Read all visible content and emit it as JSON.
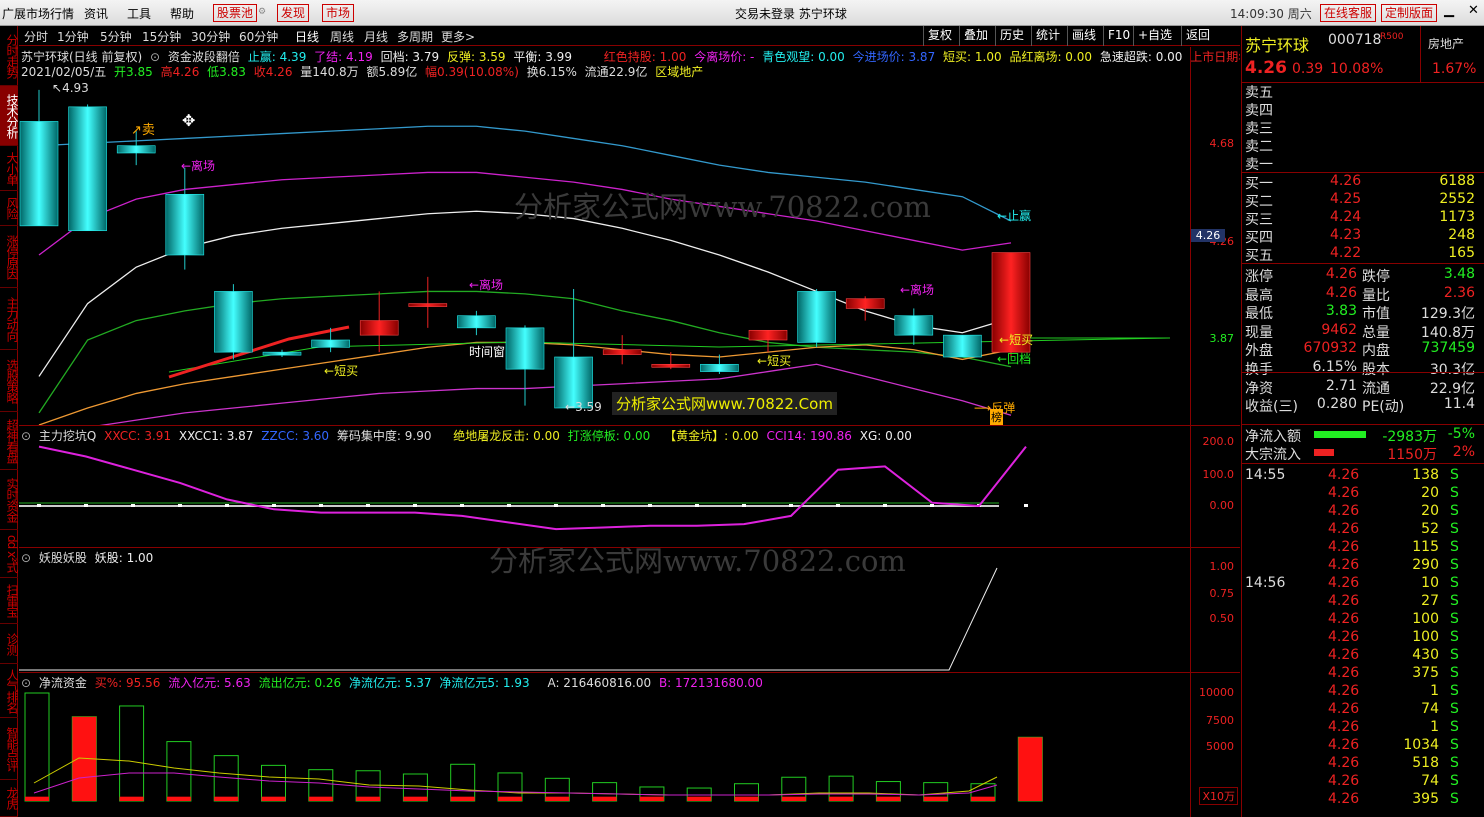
{
  "menubar": {
    "items": [
      "广展市场行情",
      "资讯",
      "工具",
      "帮助"
    ],
    "boxed": [
      "股票池",
      "发现",
      "市场"
    ],
    "center_title": "交易未登录  苏宁环球",
    "time": "14:09:30 周六",
    "btn_online": "在线客服",
    "btn_custom": "定制版面"
  },
  "left_tabs": [
    "分时走势",
    "技术分析",
    "大小单",
    "风险",
    "涨停原因",
    "主力动向",
    "选股策略",
    "超神看盘",
    "实时资金",
    "dd x²式",
    "扫雷宝",
    "诊测",
    "人气排名",
    "智能点评",
    "龙虎"
  ],
  "periods": [
    "分时",
    "1分钟",
    "5分钟",
    "15分钟",
    "30分钟",
    "60分钟",
    "日线",
    "周线",
    "月线",
    "多周期",
    "更多>"
  ],
  "tools": [
    "复权",
    "叠加",
    "历史",
    "统计",
    "画线",
    "F10",
    "+自选",
    "返回"
  ],
  "main": {
    "h1": {
      "name": "苏宁环球(日线 前复权)",
      "ind": "资金波段翻倍",
      "zy": "止赢: 4.39",
      "lj": "了结: 4.19",
      "hd": "回档: 3.79",
      "ft": "反弹: 3.59",
      "ph": "平衡: 3.99",
      "hschg": "红色持股: 1.00",
      "jlcj": "今离场价: -",
      "qsgw": "青色观望: 0.00",
      "jjcj": "今进场价: 3.87",
      "dm": "短买: 1.00",
      "pllc": "品红离场: 0.00",
      "jcsd": "急速超跌: 0.00",
      "ssrq": "上市日期年◇"
    },
    "h2": {
      "date": "2021/02/05/五",
      "open": "开3.85",
      "high": "高4.26",
      "low": "低3.83",
      "close": "收4.26",
      "vol": "量140.8万",
      "amt": "额5.89亿",
      "amp": "幅0.39(10.08%)",
      "turn": "换6.15%",
      "float": "流通22.9亿",
      "sector": "区域地产"
    },
    "price_ticks": [
      "4.68",
      "4.26",
      "3.87"
    ],
    "cur_price_tag": "4.26",
    "marks": {
      "high": "4.93",
      "low": "3.59",
      "sell": "卖",
      "exit": "←离场",
      "shortbuy": "短买",
      "time_window": "时间窗",
      "stop": "止赢",
      "pullback": "回档",
      "bounce": "反弹",
      "rank": "榜"
    },
    "watermark": "分析家公式网www.70822.com",
    "banner": "分析家公式网www.70822.Com"
  },
  "chart_data": {
    "type": "candlestick",
    "ohlc": [
      [
        4.8,
        4.93,
        4.4,
        4.37
      ],
      [
        4.86,
        4.87,
        4.35,
        4.35
      ],
      [
        4.7,
        4.76,
        4.62,
        4.67
      ],
      [
        4.5,
        4.61,
        4.19,
        4.25
      ],
      [
        4.1,
        4.13,
        3.82,
        3.85
      ],
      [
        3.85,
        3.86,
        3.83,
        3.84
      ],
      [
        3.9,
        3.95,
        3.85,
        3.87
      ],
      [
        3.92,
        4.1,
        3.85,
        3.98
      ],
      [
        4.05,
        4.16,
        3.95,
        4.05
      ],
      [
        4.0,
        4.02,
        3.92,
        3.95
      ],
      [
        3.95,
        3.96,
        3.63,
        3.78
      ],
      [
        3.83,
        4.11,
        3.62,
        3.62
      ],
      [
        3.84,
        3.92,
        3.8,
        3.86
      ],
      [
        3.8,
        3.85,
        3.78,
        3.8
      ],
      [
        3.8,
        3.84,
        3.76,
        3.77
      ],
      [
        3.9,
        3.93,
        3.85,
        3.94
      ],
      [
        4.1,
        4.11,
        3.87,
        3.89
      ],
      [
        4.03,
        4.08,
        3.98,
        4.07
      ],
      [
        4.0,
        4.03,
        3.88,
        3.92
      ],
      [
        3.92,
        3.92,
        3.83,
        3.83
      ],
      [
        3.85,
        4.26,
        3.83,
        4.26
      ]
    ],
    "ylim": [
      3.55,
      4.95
    ],
    "bands": {
      "upper": [
        4.7,
        4.71,
        4.72,
        4.73,
        4.74,
        4.75,
        4.76,
        4.77,
        4.78,
        4.78,
        4.76,
        4.73,
        4.7,
        4.66,
        4.62,
        4.59,
        4.57,
        4.55,
        4.52,
        4.49,
        4.39
      ],
      "mid_hi": [
        4.25,
        4.4,
        4.48,
        4.52,
        4.54,
        4.56,
        4.57,
        4.58,
        4.59,
        4.59,
        4.57,
        4.55,
        4.52,
        4.48,
        4.45,
        4.42,
        4.39,
        4.35,
        4.31,
        4.27,
        4.3
      ],
      "mid": [
        3.75,
        4.05,
        4.2,
        4.28,
        4.33,
        4.36,
        4.38,
        4.4,
        4.42,
        4.43,
        4.42,
        4.4,
        4.36,
        4.31,
        4.25,
        4.18,
        4.1,
        4.02,
        3.96,
        3.93,
        3.99
      ],
      "mid_lo": [
        3.6,
        3.9,
        3.98,
        4.02,
        4.05,
        4.07,
        4.08,
        4.09,
        4.1,
        4.1,
        4.09,
        4.07,
        4.02,
        3.98,
        3.93,
        3.89,
        3.87,
        3.86,
        3.85,
        3.83,
        3.79
      ],
      "lower": [
        3.55,
        3.62,
        3.68,
        3.72,
        3.75,
        3.78,
        3.81,
        3.84,
        3.87,
        3.89,
        3.89,
        3.88,
        3.86,
        3.84,
        3.83,
        3.85,
        3.87,
        3.88,
        3.86,
        3.82,
        3.86
      ],
      "bottom": [
        3.5,
        3.54,
        3.57,
        3.6,
        3.62,
        3.64,
        3.66,
        3.68,
        3.69,
        3.7,
        3.7,
        3.71,
        3.72,
        3.73,
        3.74,
        3.77,
        3.8,
        3.75,
        3.7,
        3.65,
        3.59
      ]
    }
  },
  "ind2": {
    "hdr": {
      "name": "主力挖坑Q",
      "xxcc": "XXCC: 3.91",
      "xxcc1": "XXCC1: 3.87",
      "zzcc": "ZZCC: 3.60",
      "chip": "筹码集中度: 9.90",
      "jd": "绝地屠龙反击: 0.00",
      "dz": "打涨停板: 0.00",
      "hj": "【黄金坑】: 0.00",
      "cci": "CCI14: 190.86",
      "xg": "XG: 0.00"
    },
    "ticks": [
      "200.0",
      "100.0",
      "0.00"
    ],
    "cci": [
      180,
      150,
      110,
      70,
      20,
      -10,
      -20,
      -20,
      -20,
      -30,
      -50,
      -70,
      -65,
      -60,
      -60,
      -55,
      -30,
      110,
      120,
      10,
      0,
      180
    ]
  },
  "ind3": {
    "hdr": {
      "name": "妖股妖股",
      "val": "妖股: 1.00"
    },
    "ticks": [
      "1.00",
      "0.75",
      "0.50"
    ]
  },
  "ind4": {
    "hdr": {
      "name": "净流资金",
      "buy": "买%: 95.56",
      "in": "流入亿元: 5.63",
      "out": "流出亿元: 0.26",
      "net": "净流亿元: 5.37",
      "net5": "净流亿元5: 1.93",
      "a": "A: 216460816.00",
      "b": "B: 172131680.00"
    },
    "ticks": [
      "10000",
      "7500",
      "5000"
    ],
    "unit": "X10万",
    "vol": [
      10000,
      7800,
      8800,
      5500,
      4200,
      3300,
      2900,
      2800,
      2500,
      3400,
      2600,
      2100,
      1700,
      1300,
      1200,
      1600,
      2200,
      2300,
      1800,
      1700,
      1600,
      5900
    ],
    "red": [
      400,
      7800,
      400,
      400,
      400,
      400,
      400,
      400,
      400,
      400,
      400,
      400,
      400,
      400,
      400,
      400,
      400,
      400,
      400,
      400,
      400,
      5900
    ]
  },
  "quote": {
    "name": "苏宁环球",
    "code": "000718",
    "tag": "R500",
    "sector": "房地产",
    "price": "4.26",
    "chg": "0.39",
    "pct": "10.08%",
    "rate": "1.67%",
    "asks": [
      "卖五",
      "卖四",
      "卖三",
      "卖二",
      "卖一"
    ],
    "bids": [
      [
        "买一",
        "4.26",
        "6188"
      ],
      [
        "买二",
        "4.25",
        "2552"
      ],
      [
        "买三",
        "4.24",
        "1173"
      ],
      [
        "买四",
        "4.23",
        "248"
      ],
      [
        "买五",
        "4.22",
        "165"
      ]
    ],
    "stats": [
      [
        "涨停",
        "4.26",
        "跌停",
        "3.48"
      ],
      [
        "最高",
        "4.26",
        "量比",
        "2.36"
      ],
      [
        "最低",
        "3.83",
        "市值",
        "129.3亿"
      ],
      [
        "现量",
        "9462",
        "总量",
        "140.8万"
      ],
      [
        "外盘",
        "670932",
        "内盘",
        "737459"
      ],
      [
        "换手",
        "6.15%",
        "股本",
        "30.3亿"
      ],
      [
        "净资",
        "2.71",
        "流通",
        "22.9亿"
      ],
      [
        "收益(三)",
        "0.280",
        "PE(动)",
        "11.4"
      ]
    ],
    "flow": [
      [
        "净流入额",
        "-2983万",
        "-5%"
      ],
      [
        "大宗流入",
        "1150万",
        "2%"
      ]
    ],
    "ticks_a": {
      "time": "14:55",
      "rows": [
        [
          "4.26",
          "138",
          "S"
        ],
        [
          "4.26",
          "20",
          "S"
        ],
        [
          "4.26",
          "20",
          "S"
        ],
        [
          "4.26",
          "52",
          "S"
        ],
        [
          "4.26",
          "115",
          "S"
        ],
        [
          "4.26",
          "290",
          "S"
        ]
      ]
    },
    "ticks_b": {
      "time": "14:56",
      "rows": [
        [
          "4.26",
          "10",
          "S"
        ],
        [
          "4.26",
          "27",
          "S"
        ],
        [
          "4.26",
          "100",
          "S"
        ],
        [
          "4.26",
          "100",
          "S"
        ],
        [
          "4.26",
          "430",
          "S"
        ],
        [
          "4.26",
          "375",
          "S"
        ],
        [
          "4.26",
          "1",
          "S"
        ],
        [
          "4.26",
          "74",
          "S"
        ],
        [
          "4.26",
          "1",
          "S"
        ],
        [
          "4.26",
          "1034",
          "S"
        ],
        [
          "4.26",
          "518",
          "S"
        ],
        [
          "4.26",
          "74",
          "S"
        ],
        [
          "4.26",
          "395",
          "S"
        ]
      ]
    }
  }
}
